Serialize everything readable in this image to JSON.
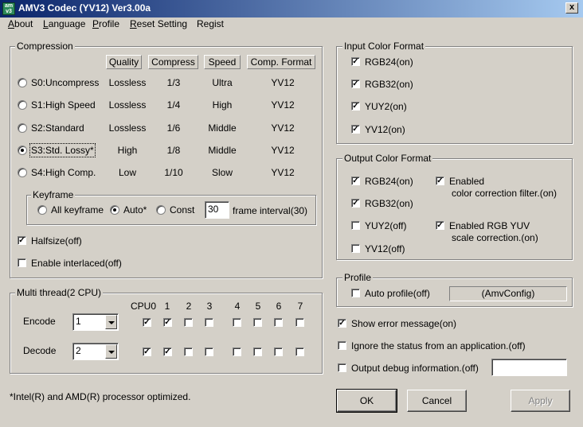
{
  "window": {
    "title": "AMV3 Codec (YV12) Ver3.00a",
    "icon_label": "am v3",
    "close_label": "x"
  },
  "menu": {
    "items": [
      {
        "first": "A",
        "rest": "bout"
      },
      {
        "first": "L",
        "rest": "anguage"
      },
      {
        "first": "P",
        "rest": "rofile"
      },
      {
        "first": "R",
        "rest": "eset Setting"
      },
      {
        "first": "",
        "rest": "Regist"
      }
    ]
  },
  "compression": {
    "title": "Compression",
    "headers": [
      "Quality",
      "Compress",
      "Speed",
      "Comp. Format"
    ],
    "rows": [
      {
        "label": "S0:Uncompress",
        "quality": "Lossless",
        "compress": "1/3",
        "speed": "Ultra",
        "format": "YV12",
        "selected": false
      },
      {
        "label": "S1:High Speed",
        "quality": "Lossless",
        "compress": "1/4",
        "speed": "High",
        "format": "YV12",
        "selected": false
      },
      {
        "label": "S2:Standard",
        "quality": "Lossless",
        "compress": "1/6",
        "speed": "Middle",
        "format": "YV12",
        "selected": false
      },
      {
        "label": "S3:Std. Lossy*",
        "quality": "High",
        "compress": "1/8",
        "speed": "Middle",
        "format": "YV12",
        "selected": true
      },
      {
        "label": "S4:High Comp.",
        "quality": "Low",
        "compress": "1/10",
        "speed": "Slow",
        "format": "YV12",
        "selected": false
      }
    ],
    "keyframe": {
      "title": "Keyframe",
      "options": [
        "All keyframe",
        "Auto*",
        "Const"
      ],
      "selected_index": 1,
      "interval_value": "30",
      "interval_label": "frame interval(30)"
    },
    "halfsize": {
      "label": "Halfsize(off)",
      "checked": true
    },
    "interlaced": {
      "label": "Enable interlaced(off)",
      "checked": false
    }
  },
  "multithread": {
    "title": "Multi thread(2 CPU)",
    "cpu_labels": [
      "CPU0",
      "1",
      "2",
      "3",
      "4",
      "5",
      "6",
      "7"
    ],
    "encode": {
      "label": "Encode",
      "value": "1",
      "cpus": [
        true,
        true,
        false,
        false,
        false,
        false,
        false,
        false
      ]
    },
    "decode": {
      "label": "Decode",
      "value": "2",
      "cpus": [
        true,
        true,
        false,
        false,
        false,
        false,
        false,
        false
      ]
    }
  },
  "input_color": {
    "title": "Input Color Format",
    "items": [
      {
        "label": "RGB24(on)",
        "checked": true
      },
      {
        "label": "RGB32(on)",
        "checked": true
      },
      {
        "label": "YUY2(on)",
        "checked": true
      },
      {
        "label": "YV12(on)",
        "checked": true
      }
    ]
  },
  "output_color": {
    "title": "Output Color Format",
    "items": [
      {
        "label": "RGB24(on)",
        "checked": true
      },
      {
        "label": "RGB32(on)",
        "checked": true
      },
      {
        "label": "YUY2(off)",
        "checked": false
      },
      {
        "label": "YV12(off)",
        "checked": false
      }
    ],
    "color_filter": {
      "line1": "Enabled",
      "line2": "color correction filter.(on)",
      "checked": true
    },
    "yuv_scale": {
      "line1": "Enabled RGB YUV",
      "line2": "scale correction.(on)",
      "checked": true
    }
  },
  "profile": {
    "title": "Profile",
    "auto_profile": {
      "label": "Auto profile(off)",
      "checked": false
    },
    "config_name": "(AmvConfig)"
  },
  "options": {
    "show_error": {
      "label": "Show error message(on)",
      "checked": true
    },
    "ignore_status": {
      "label": "Ignore the status from an application.(off)",
      "checked": false
    },
    "output_debug": {
      "label": "Output debug information.(off)",
      "checked": false,
      "value": ""
    }
  },
  "footer_note": "*Intel(R) and AMD(R) processor optimized.",
  "buttons": {
    "ok": "OK",
    "cancel": "Cancel",
    "apply": "Apply"
  }
}
